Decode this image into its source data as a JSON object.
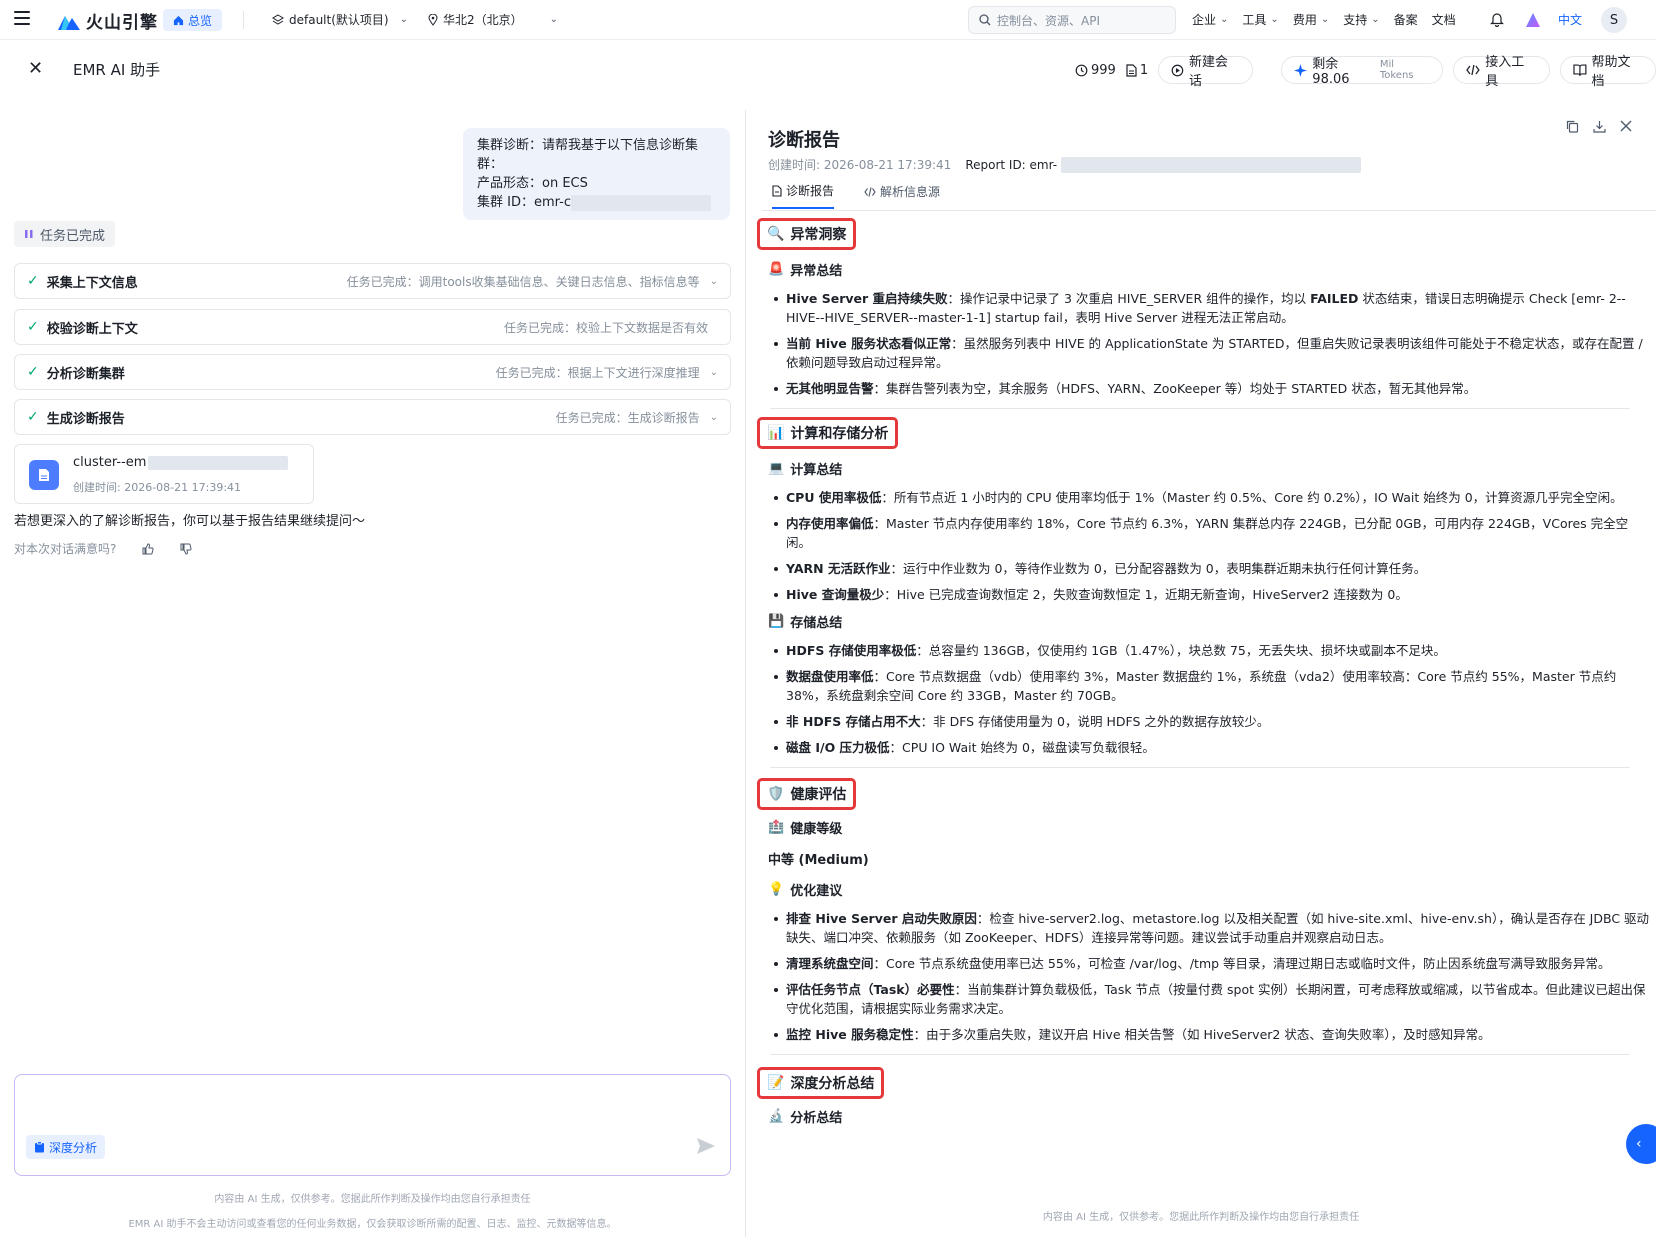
{
  "topnav": {
    "brand": "火山引擎",
    "home": "总览",
    "project": "default(默认项目)",
    "region": "华北2（北京）",
    "search_placeholder": "控制台、资源、API",
    "links": [
      "企业",
      "工具",
      "费用",
      "支持",
      "备案",
      "文档"
    ],
    "language": "中文",
    "avatar": "S"
  },
  "header": {
    "title": "EMR AI 助手",
    "history_count": "999",
    "doc_count": "1",
    "new_chat": "新建会话",
    "remaining_label": "剩余98.06",
    "remaining_unit": "Mil Tokens",
    "connect_tools": "接入工具",
    "help_docs": "帮助文档"
  },
  "chat": {
    "user_message": {
      "line1": "集群诊断：请帮我基于以下信息诊断集群：",
      "line2": "产品形态：on ECS",
      "line3": "集群 ID：emr-c"
    },
    "task_status": "任务已完成",
    "steps": [
      {
        "title": "采集上下文信息",
        "desc": "任务已完成：调用tools收集基础信息、关键日志信息、指标信息等"
      },
      {
        "title": "校验诊断上下文",
        "desc": "任务已完成：校验上下文数据是否有效"
      },
      {
        "title": "分析诊断集群",
        "desc": "任务已完成：根据上下文进行深度推理"
      },
      {
        "title": "生成诊断报告",
        "desc": "任务已完成：生成诊断报告"
      }
    ],
    "file": {
      "name": "cluster--em",
      "created": "创建时间: 2026-08-21 17:39:41"
    },
    "followup": "若想更深入的了解诊断报告，你可以基于报告结果继续提问～",
    "satisfaction": "对本次对话满意吗?",
    "input_placeholder": "",
    "deep_analysis": "深度分析",
    "disclaimer1": "内容由 AI 生成，仅供参考。您据此所作判断及操作均由您自行承担责任",
    "disclaimer2": "EMR AI 助手不会主动访问或查看您的任何业务数据，仅会获取诊断所需的配置、日志、监控、元数据等信息。"
  },
  "report": {
    "title": "诊断报告",
    "created": "创建时间: 2026-08-21 17:39:41",
    "report_id": "Report ID: emr-",
    "tabs": [
      "诊断报告",
      "解析信息源"
    ],
    "sections": {
      "anomaly": {
        "title": "异常洞察",
        "sub": "异常总结",
        "items": [
          {
            "b": "Hive Server 重启持续失败",
            "t": "：操作记录中记录了 3 次重启 HIVE_SERVER 组件的操作，均以 ",
            "b2": "FAILED",
            "t2": " 状态结束，错误日志明确提示 Check [emr-                    2--HIVE--HIVE_SERVER--master-1-1] startup fail，表明 Hive Server 进程无法正常启动。"
          },
          {
            "b": "当前 Hive 服务状态看似正常",
            "t": "：虽然服务列表中 HIVE 的 ApplicationState 为 STARTED，但重启失败记录表明该组件可能处于不稳定状态，或存在配置 / 依赖问题导致启动过程异常。"
          },
          {
            "b": "无其他明显告警",
            "t": "：集群告警列表为空，其余服务（HDFS、YARN、ZooKeeper 等）均处于 STARTED 状态，暂无其他异常。"
          }
        ]
      },
      "compute": {
        "title": "计算和存储分析",
        "sub1": "计算总结",
        "items1": [
          {
            "b": "CPU 使用率极低",
            "t": "：所有节点近 1 小时内的 CPU 使用率均低于 1%（Master 约 0.5%、Core 约 0.2%），IO Wait 始终为 0，计算资源几乎完全空闲。"
          },
          {
            "b": "内存使用率偏低",
            "t": "：Master 节点内存使用率约 18%，Core 节点约 6.3%，YARN 集群总内存 224GB，已分配 0GB，可用内存 224GB，VCores 完全空闲。"
          },
          {
            "b": "YARN 无活跃作业",
            "t": "：运行中作业数为 0，等待作业数为 0，已分配容器数为 0，表明集群近期未执行任何计算任务。"
          },
          {
            "b": "Hive 查询量极少",
            "t": "：Hive 已完成查询数恒定 2，失败查询数恒定 1，近期无新查询，HiveServer2 连接数为 0。"
          }
        ],
        "sub2": "存储总结",
        "items2": [
          {
            "b": "HDFS 存储使用率极低",
            "t": "：总容量约 136GB，仅使用约 1GB（1.47%），块总数 75，无丢失块、损坏块或副本不足块。"
          },
          {
            "b": "数据盘使用率低",
            "t": "：Core 节点数据盘（vdb）使用率约 3%，Master 数据盘约 1%，系统盘（vda2）使用率较高：Core 节点约 55%，Master 节点约 38%，系统盘剩余空间 Core 约 33GB，Master 约 70GB。"
          },
          {
            "b": "非 HDFS 存储占用不大",
            "t": "：非 DFS 存储使用量为 0，说明 HDFS 之外的数据存放较少。"
          },
          {
            "b": "磁盘 I/O 压力极低",
            "t": "：CPU IO Wait 始终为 0，磁盘读写负载很轻。"
          }
        ]
      },
      "health": {
        "title": "健康评估",
        "sub1": "健康等级",
        "level": "中等 (Medium)",
        "sub2": "优化建议",
        "items": [
          {
            "b": "排查 Hive Server 启动失败原因",
            "t": "：检查 hive-server2.log、metastore.log 以及相关配置（如 hive-site.xml、hive-env.sh），确认是否存在 JDBC 驱动缺失、端口冲突、依赖服务（如 ZooKeeper、HDFS）连接异常等问题。建议尝试手动重启并观察启动日志。"
          },
          {
            "b": "清理系统盘空间",
            "t": "：Core 节点系统盘使用率已达 55%，可检查 /var/log、/tmp 等目录，清理过期日志或临时文件，防止因系统盘写满导致服务异常。"
          },
          {
            "b": "评估任务节点（Task）必要性",
            "t": "：当前集群计算负载极低，Task 节点（按量付费 spot 实例）长期闲置，可考虑释放或缩减，以节省成本。但此建议已超出保守优化范围，请根据实际业务需求决定。"
          },
          {
            "b": "监控 Hive 服务稳定性",
            "t": "：由于多次重启失败，建议开启 Hive 相关告警（如 HiveServer2 状态、查询失败率），及时感知异常。"
          }
        ]
      },
      "deep": {
        "title": "深度分析总结",
        "sub": "分析总结"
      }
    },
    "disclaimer": "内容由 AI 生成，仅供参考。您据此所作判断及操作均由您自行承担责任"
  }
}
